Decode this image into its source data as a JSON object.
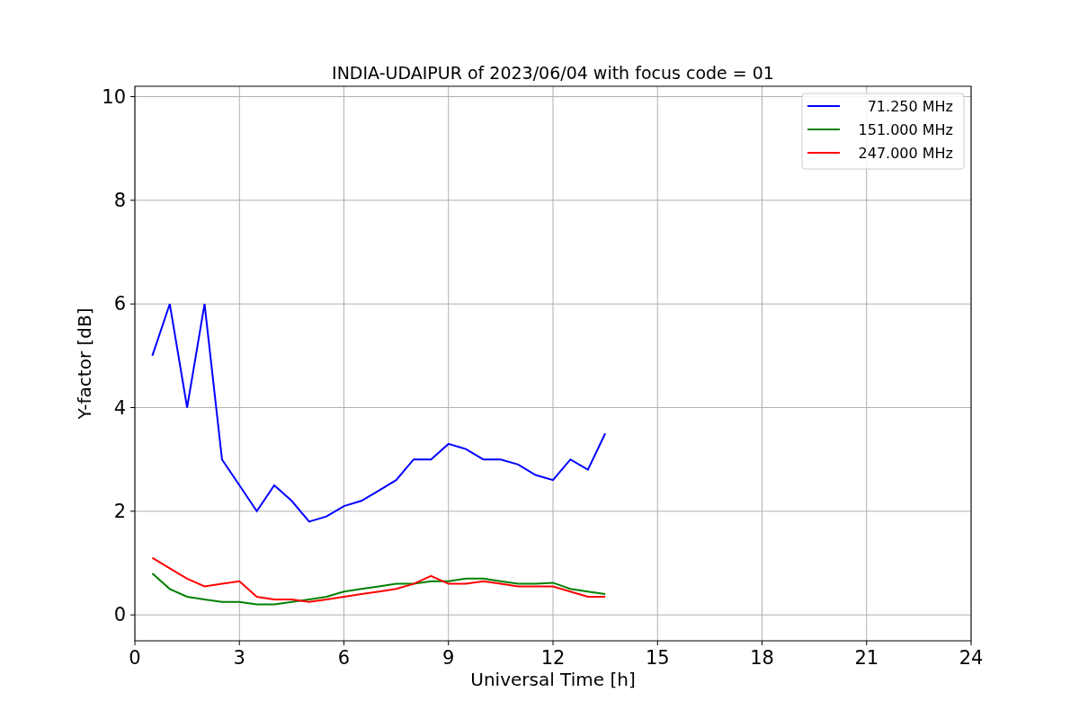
{
  "chart_data": {
    "type": "line",
    "title": "INDIA-UDAIPUR of 2023/06/04 with focus code = 01",
    "xlabel": "Universal Time [h]",
    "ylabel": "Y-factor [dB]",
    "x": [
      0.5,
      1.0,
      1.5,
      2.0,
      2.5,
      3.0,
      3.5,
      4.0,
      4.5,
      5.0,
      5.5,
      6.0,
      6.5,
      7.0,
      7.5,
      8.0,
      8.5,
      9.0,
      9.5,
      10.0,
      10.5,
      11.0,
      11.5,
      12.0,
      12.5,
      13.0,
      13.5
    ],
    "series": [
      {
        "name": "71.250 MHz",
        "color": "#0000ff",
        "values": [
          5.0,
          6.0,
          4.0,
          6.0,
          3.0,
          2.5,
          2.0,
          2.5,
          2.2,
          1.8,
          1.9,
          2.1,
          2.2,
          2.4,
          2.6,
          3.0,
          3.0,
          3.3,
          3.2,
          3.0,
          3.0,
          2.9,
          2.7,
          2.6,
          3.0,
          2.8,
          3.5
        ]
      },
      {
        "name": "151.000 MHz",
        "color": "#008000",
        "values": [
          0.8,
          0.5,
          0.35,
          0.3,
          0.25,
          0.25,
          0.2,
          0.2,
          0.25,
          0.3,
          0.35,
          0.45,
          0.5,
          0.55,
          0.6,
          0.6,
          0.65,
          0.65,
          0.7,
          0.7,
          0.65,
          0.6,
          0.6,
          0.62,
          0.5,
          0.45,
          0.4
        ]
      },
      {
        "name": "247.000 MHz",
        "color": "#ff0000",
        "values": [
          1.1,
          0.9,
          0.7,
          0.55,
          0.6,
          0.65,
          0.35,
          0.3,
          0.3,
          0.25,
          0.3,
          0.35,
          0.4,
          0.45,
          0.5,
          0.6,
          0.75,
          0.6,
          0.6,
          0.65,
          0.6,
          0.55,
          0.55,
          0.55,
          0.45,
          0.35,
          0.35
        ]
      }
    ],
    "xlim": [
      0,
      24
    ],
    "ylim": [
      -0.5,
      10.2
    ],
    "xticks": [
      0,
      3,
      6,
      9,
      12,
      15,
      18,
      21,
      24
    ],
    "yticks": [
      0,
      2,
      4,
      6,
      8,
      10
    ],
    "grid": true,
    "legend": true
  }
}
